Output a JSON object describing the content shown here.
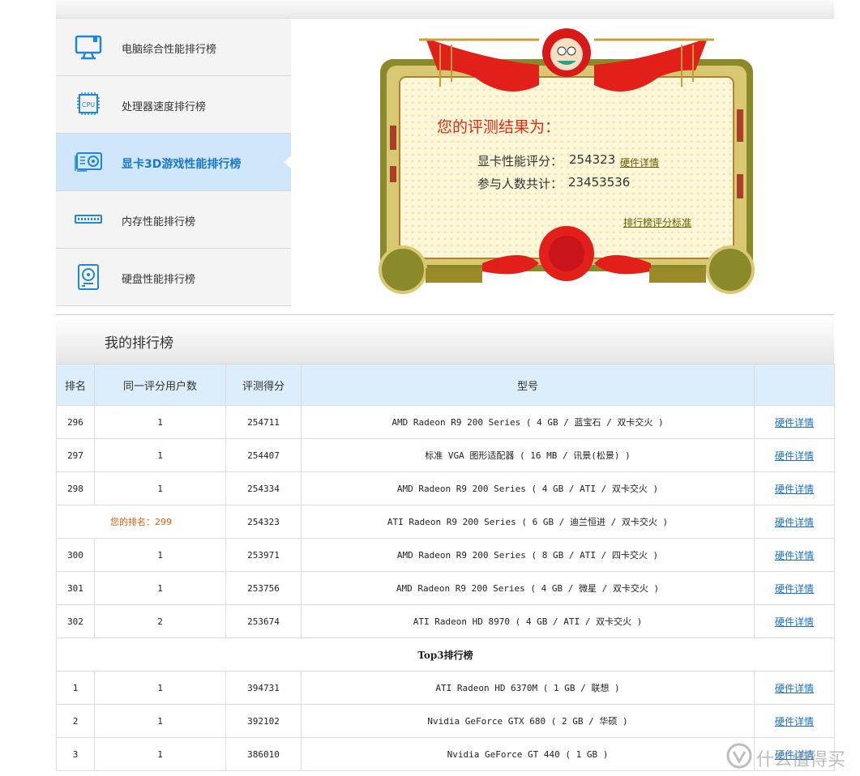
{
  "sidebar": {
    "items": [
      {
        "label": "电脑综合性能排行榜"
      },
      {
        "label": "处理器速度排行榜"
      },
      {
        "label": "显卡3D游戏性能排行榜"
      },
      {
        "label": "内存性能排行榜"
      },
      {
        "label": "硬盘性能排行榜"
      }
    ],
    "active_index": 2
  },
  "certificate": {
    "heading": "您的评测结果为：",
    "score_label": "显卡性能评分：",
    "score_value": "254323",
    "detail_link": "硬件详情",
    "count_label": "参与人数共计：",
    "count_value": "23453536",
    "standard_link": "排行榜评分标准"
  },
  "ranking": {
    "title": "我的排行榜",
    "headers": [
      "排名",
      "同一评分用户数",
      "评测得分",
      "型号",
      ""
    ],
    "link_text": "硬件详情",
    "rows": [
      {
        "rank": "296",
        "users": "1",
        "score": "254711",
        "model": "AMD Radeon R9 200 Series ( 4 GB / 蓝宝石 / 双卡交火 )"
      },
      {
        "rank": "297",
        "users": "1",
        "score": "254407",
        "model": "标准 VGA 图形适配器 ( 16 MB / 讯景(松景) )"
      },
      {
        "rank": "298",
        "users": "1",
        "score": "254334",
        "model": "AMD Radeon R9 200 Series ( 4 GB / ATI / 双卡交火 )"
      },
      {
        "mine": "您的排名：299",
        "score": "254323",
        "model": "ATI Radeon R9 200 Series ( 6 GB / 迪兰恒进 / 双卡交火 )"
      },
      {
        "rank": "300",
        "users": "1",
        "score": "253971",
        "model": "AMD Radeon R9 200 Series ( 8 GB / ATI / 四卡交火 )"
      },
      {
        "rank": "301",
        "users": "1",
        "score": "253756",
        "model": "AMD Radeon R9 200 Series ( 4 GB / 微星 / 双卡交火 )"
      },
      {
        "rank": "302",
        "users": "2",
        "score": "253674",
        "model": "ATI Radeon HD 8970 ( 4 GB / ATI / 双卡交火 )"
      }
    ],
    "section_title": "Top3排行榜",
    "top_rows": [
      {
        "rank": "1",
        "users": "1",
        "score": "394731",
        "model": "ATI Radeon HD 6370M ( 1 GB / 联想 )"
      },
      {
        "rank": "2",
        "users": "1",
        "score": "392102",
        "model": "Nvidia GeForce GTX 680 ( 2 GB / 华硕 )"
      },
      {
        "rank": "3",
        "users": "1",
        "score": "386010",
        "model": "Nvidia GeForce GT 440 ( 1 GB )"
      }
    ]
  },
  "watermark": {
    "text": "什么值得买"
  }
}
